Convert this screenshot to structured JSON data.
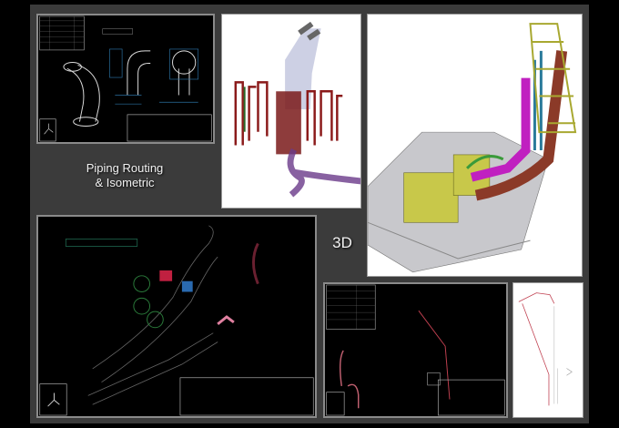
{
  "captions": {
    "routing_line1": "Piping Routing",
    "routing_line2": "& Isometric",
    "three_d": "3D"
  },
  "colors": {
    "slide_bg": "#3b3b3b",
    "cad_bg": "#000000",
    "pipe_red": "#8b2a1e",
    "pipe_magenta": "#c020c0",
    "struct_yellow": "#c8c850",
    "cad_green": "#3a8a4a",
    "cad_blue": "#2a7ab0"
  }
}
